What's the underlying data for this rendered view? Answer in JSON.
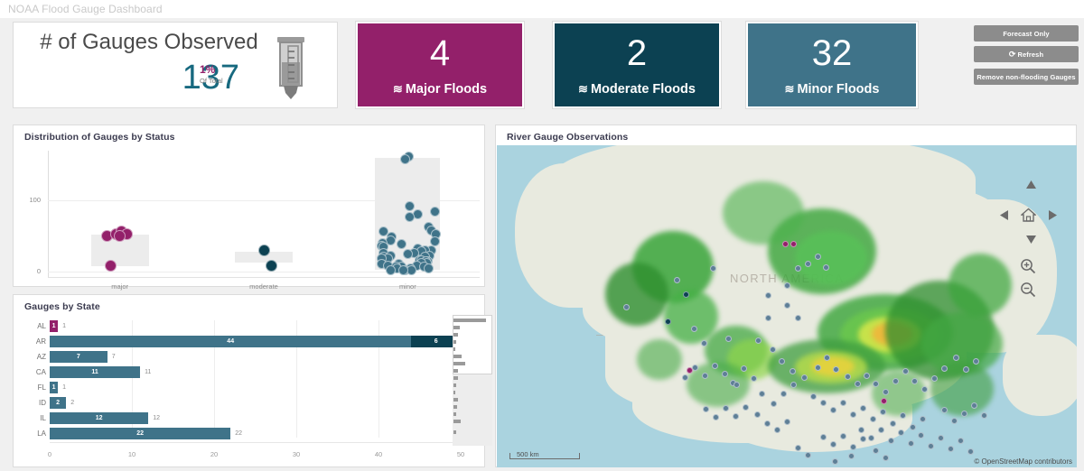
{
  "app": {
    "title": "NOAA Flood Gauge Dashboard"
  },
  "kpi_gauges": {
    "heading": "# of Gauges Observed",
    "value": "137",
    "percent": "1%",
    "sub": "Of Total",
    "icon": "rain-gauge-icon",
    "value_color": "#17697f",
    "percent_color": "#93206a"
  },
  "flood_tiles": [
    {
      "key": "major",
      "value": "4",
      "label": "Major Floods",
      "color": "#93206a",
      "icon": "waves-icon"
    },
    {
      "key": "moderate",
      "value": "2",
      "label": "Moderate Floods",
      "color": "#0c4152",
      "icon": "waves-icon"
    },
    {
      "key": "minor",
      "value": "32",
      "label": "Minor Floods",
      "color": "#3f7389",
      "icon": "waves-icon"
    }
  ],
  "actions": [
    {
      "key": "forecast",
      "label": "Forecast Only",
      "icon": null
    },
    {
      "key": "refresh",
      "label": "Refresh",
      "icon": "refresh-icon"
    },
    {
      "key": "remove",
      "label": "Remove non-flooding Gauges",
      "icon": null
    }
  ],
  "distribution": {
    "title": "Distribution of Gauges by Status"
  },
  "state_chart": {
    "title": "Gauges by State"
  },
  "map": {
    "title": "River Gauge Observations",
    "continent_label": "NORTH AMERICA",
    "scale_label": "500 km",
    "attribution": "© OpenStreetMap contributors",
    "controls": [
      {
        "key": "pan-up",
        "icon": "arrow-up-icon"
      },
      {
        "key": "pan-left",
        "icon": "arrow-left-icon"
      },
      {
        "key": "home",
        "icon": "home-icon"
      },
      {
        "key": "pan-right",
        "icon": "arrow-right-icon"
      },
      {
        "key": "pan-down",
        "icon": "arrow-down-icon"
      },
      {
        "key": "zoom-in",
        "icon": "zoom-in-icon"
      },
      {
        "key": "zoom-out",
        "icon": "zoom-out-icon"
      }
    ]
  },
  "chart_data": [
    {
      "type": "scatter",
      "id": "distribution-of-gauges-by-status",
      "title": "Distribution of Gauges by Status",
      "xlabel": "",
      "ylabel": "",
      "categories": [
        "major",
        "moderate",
        "minor"
      ],
      "yticks": [
        0,
        100
      ],
      "ylim": [
        -8,
        170
      ],
      "grid": true,
      "series": [
        {
          "name": "major",
          "color": "#93206a",
          "box": {
            "q1": 7,
            "q3": 52
          },
          "values": [
            50,
            52,
            56,
            52,
            50,
            8
          ]
        },
        {
          "name": "moderate",
          "color": "#0c4152",
          "box": {
            "q1": 12,
            "q3": 28
          },
          "values": [
            30,
            8
          ]
        },
        {
          "name": "minor",
          "color": "#3f7389",
          "box": {
            "q1": 2,
            "q3": 160
          },
          "values": [
            162,
            158,
            92,
            84,
            80,
            76,
            62,
            58,
            56,
            52,
            48,
            44,
            42,
            40,
            38,
            36,
            34,
            32,
            30,
            30,
            28,
            26,
            26,
            24,
            22,
            22,
            20,
            20,
            18,
            18,
            16,
            16,
            14,
            14,
            12,
            12,
            10,
            10,
            8,
            8,
            6,
            6,
            6,
            4,
            4,
            4,
            2,
            2,
            2,
            2
          ]
        }
      ]
    },
    {
      "type": "bar",
      "id": "gauges-by-state",
      "title": "Gauges by State",
      "orientation": "horizontal",
      "xlabel": "",
      "ylabel": "",
      "xticks": [
        0,
        10,
        20,
        30,
        40,
        50
      ],
      "xlim": [
        0,
        50
      ],
      "grid": true,
      "categories": [
        "AL",
        "AR",
        "AZ",
        "CA",
        "FL",
        "ID",
        "IL",
        "LA"
      ],
      "rows": [
        {
          "state": "AL",
          "total": 1,
          "label": "1",
          "segments": [
            {
              "status": "major",
              "value": 1,
              "color": "#93206a",
              "label": "1"
            }
          ]
        },
        {
          "state": "AR",
          "total": 50,
          "label": "",
          "segments": [
            {
              "status": "minor",
              "value": 44,
              "color": "#3f7389",
              "label": "44"
            },
            {
              "status": "moderate",
              "value": 6,
              "color": "#0c4152",
              "label": "6"
            }
          ]
        },
        {
          "state": "AZ",
          "total": 7,
          "label": "7",
          "segments": [
            {
              "status": "minor",
              "value": 7,
              "color": "#3f7389",
              "label": "7"
            }
          ]
        },
        {
          "state": "CA",
          "total": 11,
          "label": "11",
          "segments": [
            {
              "status": "minor",
              "value": 11,
              "color": "#3f7389",
              "label": "11"
            }
          ]
        },
        {
          "state": "FL",
          "total": 1,
          "label": "1",
          "segments": [
            {
              "status": "minor",
              "value": 1,
              "color": "#3f7389",
              "label": "1"
            }
          ]
        },
        {
          "state": "ID",
          "total": 2,
          "label": "2",
          "segments": [
            {
              "status": "minor",
              "value": 2,
              "color": "#3f7389",
              "label": "2"
            }
          ]
        },
        {
          "state": "IL",
          "total": 12,
          "label": "12",
          "segments": [
            {
              "status": "minor",
              "value": 12,
              "color": "#3f7389",
              "label": "12"
            }
          ]
        },
        {
          "state": "LA",
          "total": 22,
          "label": "22",
          "segments": [
            {
              "status": "minor",
              "value": 22,
              "color": "#3f7389",
              "label": "22"
            }
          ]
        }
      ]
    }
  ]
}
